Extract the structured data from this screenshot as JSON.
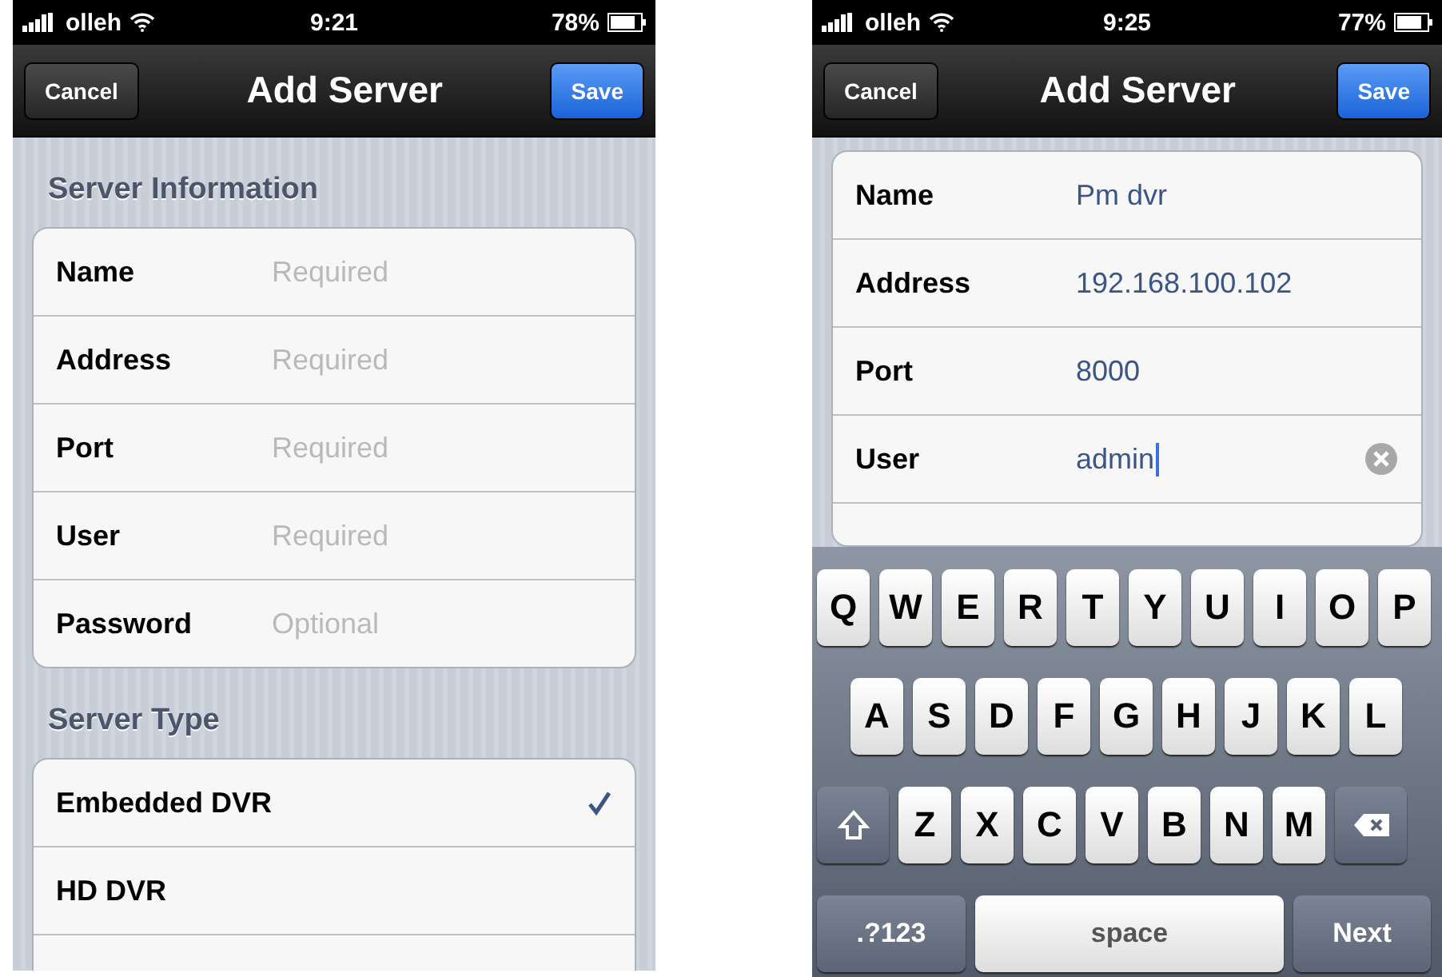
{
  "screens": [
    {
      "status_bar": {
        "carrier": "olleh",
        "time": "9:21",
        "battery": "78%"
      },
      "nav_bar": {
        "title": "Add Server",
        "left_button": "Cancel",
        "right_button": "Save"
      },
      "sections": [
        {
          "header": "Server Information",
          "kind": "fields",
          "rows": [
            {
              "label": "Name",
              "placeholder": "Required",
              "focused": false
            },
            {
              "label": "Address",
              "placeholder": "Required",
              "focused": false
            },
            {
              "label": "Port",
              "placeholder": "Required",
              "focused": false
            },
            {
              "label": "User",
              "placeholder": "Required",
              "focused": false
            },
            {
              "label": "Password",
              "placeholder": "Optional",
              "focused": false
            }
          ]
        },
        {
          "header": "Server Type",
          "kind": "options",
          "rows": [
            {
              "label": "Embedded DVR",
              "selected": true
            },
            {
              "label": "HD DVR",
              "selected": false
            },
            {
              "selected": false
            }
          ]
        }
      ]
    },
    {
      "status_bar": {
        "carrier": "olleh",
        "time": "9:25",
        "battery": "77%"
      },
      "nav_bar": {
        "title": "Add Server",
        "left_button": "Cancel",
        "right_button": "Save"
      },
      "sections": [
        {
          "kind": "fields",
          "rows": [
            {
              "label": "Name",
              "value": "Pm dvr",
              "focused": false
            },
            {
              "label": "Address",
              "value": "192.168.100.102",
              "focused": false
            },
            {
              "label": "Port",
              "value": "8000",
              "focused": false
            },
            {
              "label": "User",
              "value": "admin",
              "focused": true
            },
            {}
          ]
        }
      ],
      "keyboard": {
        "rows": [
          {
            "keys": [
              {
                "kind": "letter",
                "label": "Q"
              },
              {
                "kind": "letter",
                "label": "W"
              },
              {
                "kind": "letter",
                "label": "E"
              },
              {
                "kind": "letter",
                "label": "R"
              },
              {
                "kind": "letter",
                "label": "T"
              },
              {
                "kind": "letter",
                "label": "Y"
              },
              {
                "kind": "letter",
                "label": "U"
              },
              {
                "kind": "letter",
                "label": "I"
              },
              {
                "kind": "letter",
                "label": "O"
              },
              {
                "kind": "letter",
                "label": "P"
              }
            ]
          },
          {
            "keys": [
              {
                "kind": "letter",
                "label": "A"
              },
              {
                "kind": "letter",
                "label": "S"
              },
              {
                "kind": "letter",
                "label": "D"
              },
              {
                "kind": "letter",
                "label": "F"
              },
              {
                "kind": "letter",
                "label": "G"
              },
              {
                "kind": "letter",
                "label": "H"
              },
              {
                "kind": "letter",
                "label": "J"
              },
              {
                "kind": "letter",
                "label": "K"
              },
              {
                "kind": "letter",
                "label": "L"
              }
            ]
          },
          {
            "keys": [
              {
                "kind": "shift"
              },
              {
                "kind": "letter",
                "label": "Z"
              },
              {
                "kind": "letter",
                "label": "X"
              },
              {
                "kind": "letter",
                "label": "C"
              },
              {
                "kind": "letter",
                "label": "V"
              },
              {
                "kind": "letter",
                "label": "B"
              },
              {
                "kind": "letter",
                "label": "N"
              },
              {
                "kind": "letter",
                "label": "M"
              },
              {
                "kind": "delete"
              }
            ]
          },
          {
            "keys": [
              {
                "kind": "mode",
                "label": ".?123"
              },
              {
                "kind": "space",
                "label": "space"
              },
              {
                "kind": "return",
                "label": "Next"
              }
            ]
          }
        ]
      }
    }
  ]
}
